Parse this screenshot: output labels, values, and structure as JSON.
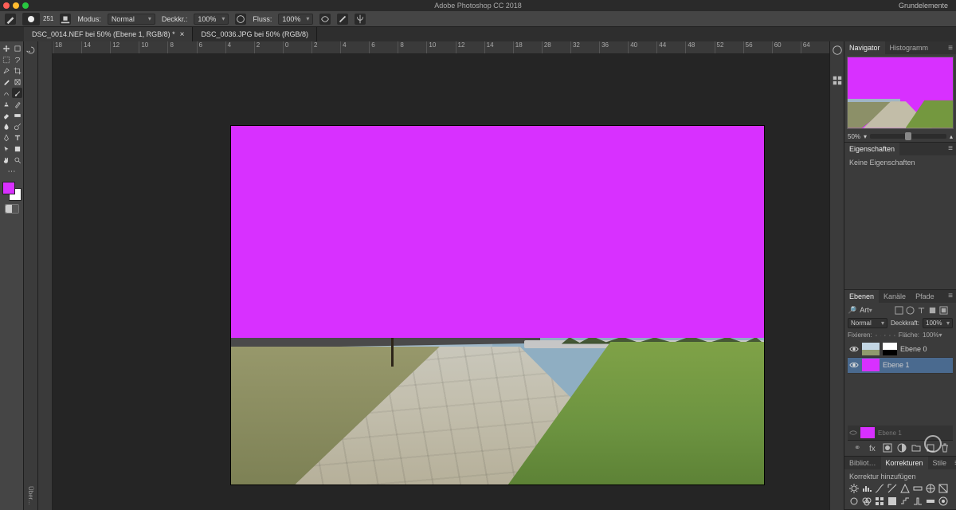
{
  "app_title": "Adobe Photoshop CC 2018",
  "workspace": "Grundelemente",
  "options": {
    "brush_size": "251",
    "mode_label": "Modus:",
    "mode_value": "Normal",
    "opacity_label": "Deckkr.:",
    "opacity_value": "100%",
    "flow_label": "Fluss:",
    "flow_value": "100%"
  },
  "tabs": [
    {
      "label": "DSC_0014.NEF bei 50% (Ebene 1, RGB/8) *",
      "active": true
    },
    {
      "label": "DSC_0036.JPG bei 50% (RGB/8)",
      "active": false
    }
  ],
  "ruler_ticks": [
    "18",
    "14",
    "12",
    "10",
    "8",
    "6",
    "4",
    "2",
    "0",
    "2",
    "4",
    "6",
    "8",
    "10",
    "12",
    "14",
    "18",
    "28",
    "32",
    "36",
    "40",
    "44",
    "48",
    "52",
    "56",
    "60",
    "64"
  ],
  "left_strip_label": "Über...",
  "navigator": {
    "tabs": [
      "Navigator",
      "Histogramm"
    ],
    "zoom": "50%"
  },
  "properties": {
    "tab": "Eigenschaften",
    "body": "Keine Eigenschaften"
  },
  "layers": {
    "tabs": [
      "Ebenen",
      "Kanäle",
      "Pfade"
    ],
    "search_kind_label": "Art",
    "blend_mode": "Normal",
    "opacity_label": "Deckkraft:",
    "opacity_value": "100%",
    "lock_label": "Fixieren:",
    "fill_label": "Fläche:",
    "fill_value": "100%",
    "items": [
      {
        "name": "Ebene 0",
        "selected": false,
        "has_mask": true
      },
      {
        "name": "Ebene 1",
        "selected": true,
        "has_mask": false,
        "magenta": true
      }
    ],
    "mini_layer": "Ebene 1"
  },
  "adjust": {
    "tabs": [
      "Bibliot…",
      "Korrekturen",
      "Stile"
    ],
    "body": "Korrektur hinzufügen"
  }
}
